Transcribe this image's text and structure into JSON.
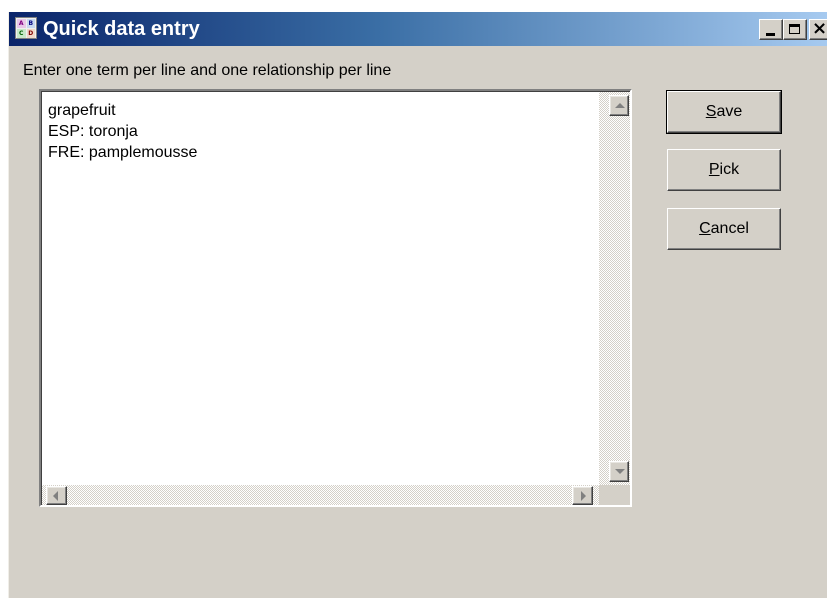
{
  "window": {
    "title": "Quick data entry"
  },
  "instruction": "Enter one term per line and one relationship per line",
  "memo": {
    "text": "grapefruit\nESP: toronja\nFRE: pamplemousse"
  },
  "buttons": {
    "save": {
      "accel": "S",
      "rest": "ave"
    },
    "pick": {
      "accel": "P",
      "rest": "ick"
    },
    "cancel": {
      "accel": "C",
      "rest": "ancel"
    }
  },
  "colors": {
    "titlebar_start": "#0a246a",
    "titlebar_end": "#a6caf0",
    "dialog_face": "#d4d0c8"
  },
  "icons": {
    "app": "app-grid-icon",
    "minimize": "minimize-icon",
    "maximize": "maximize-icon",
    "close": "close-icon"
  }
}
